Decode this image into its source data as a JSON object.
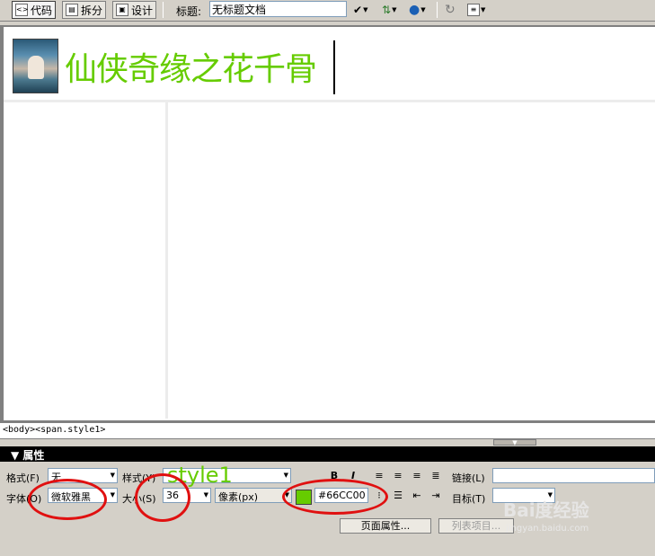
{
  "toolbar": {
    "code_label": "代码",
    "split_label": "拆分",
    "design_label": "设计",
    "title_label": "标题:",
    "title_value": "无标题文档"
  },
  "document": {
    "heading": "仙侠奇缘之花千骨",
    "heading_color": "#66CC00"
  },
  "statusbar": {
    "tag_path": "<body><span.style1>"
  },
  "panel": {
    "title": "▼ 属性"
  },
  "properties": {
    "format_label": "格式(F)",
    "format_value": "无",
    "style_label": "样式(Y)",
    "style_value": "style1",
    "font_label": "字体(O)",
    "font_value": "微软雅黑",
    "size_label": "大小(S)",
    "size_value": "36",
    "unit_value": "像素(px)",
    "color_value": "#66CC00",
    "link_label": "链接(L)",
    "target_label": "目标(T)",
    "page_props_button": "页面属性...",
    "list_item_button": "列表项目..."
  },
  "watermark": {
    "brand": "Bai度经验",
    "url": "jingyan.baidu.com"
  },
  "colors": {
    "highlight": "#e01010",
    "accent": "#66CC00"
  }
}
